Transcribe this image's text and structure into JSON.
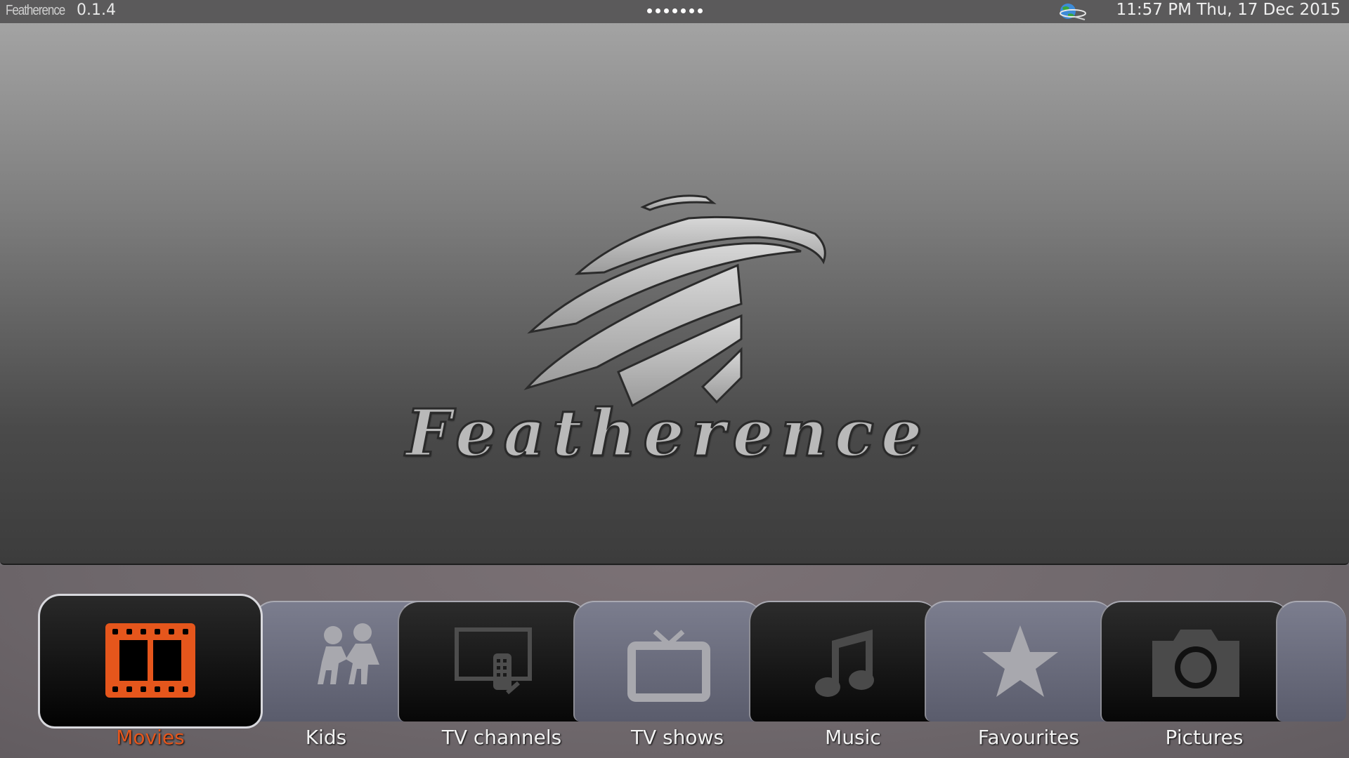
{
  "topbar": {
    "brand_name": "Featherence",
    "version": "0.1.4",
    "page_dots": 7,
    "weather_icon": "weather-globe-icon",
    "clock": "11:57 PM Thu, 17 Dec 2015"
  },
  "main": {
    "logo_text": "Featherence"
  },
  "menu": {
    "selected_index": 0,
    "accent_color": "#e5561c",
    "items": [
      {
        "label": "Movies",
        "icon": "film-icon"
      },
      {
        "label": "Kids",
        "icon": "kids-icon"
      },
      {
        "label": "TV channels",
        "icon": "tv-remote-icon"
      },
      {
        "label": "TV shows",
        "icon": "tv-icon"
      },
      {
        "label": "Music",
        "icon": "music-note-icon"
      },
      {
        "label": "Favourites",
        "icon": "star-icon"
      },
      {
        "label": "Pictures",
        "icon": "camera-icon"
      }
    ]
  }
}
